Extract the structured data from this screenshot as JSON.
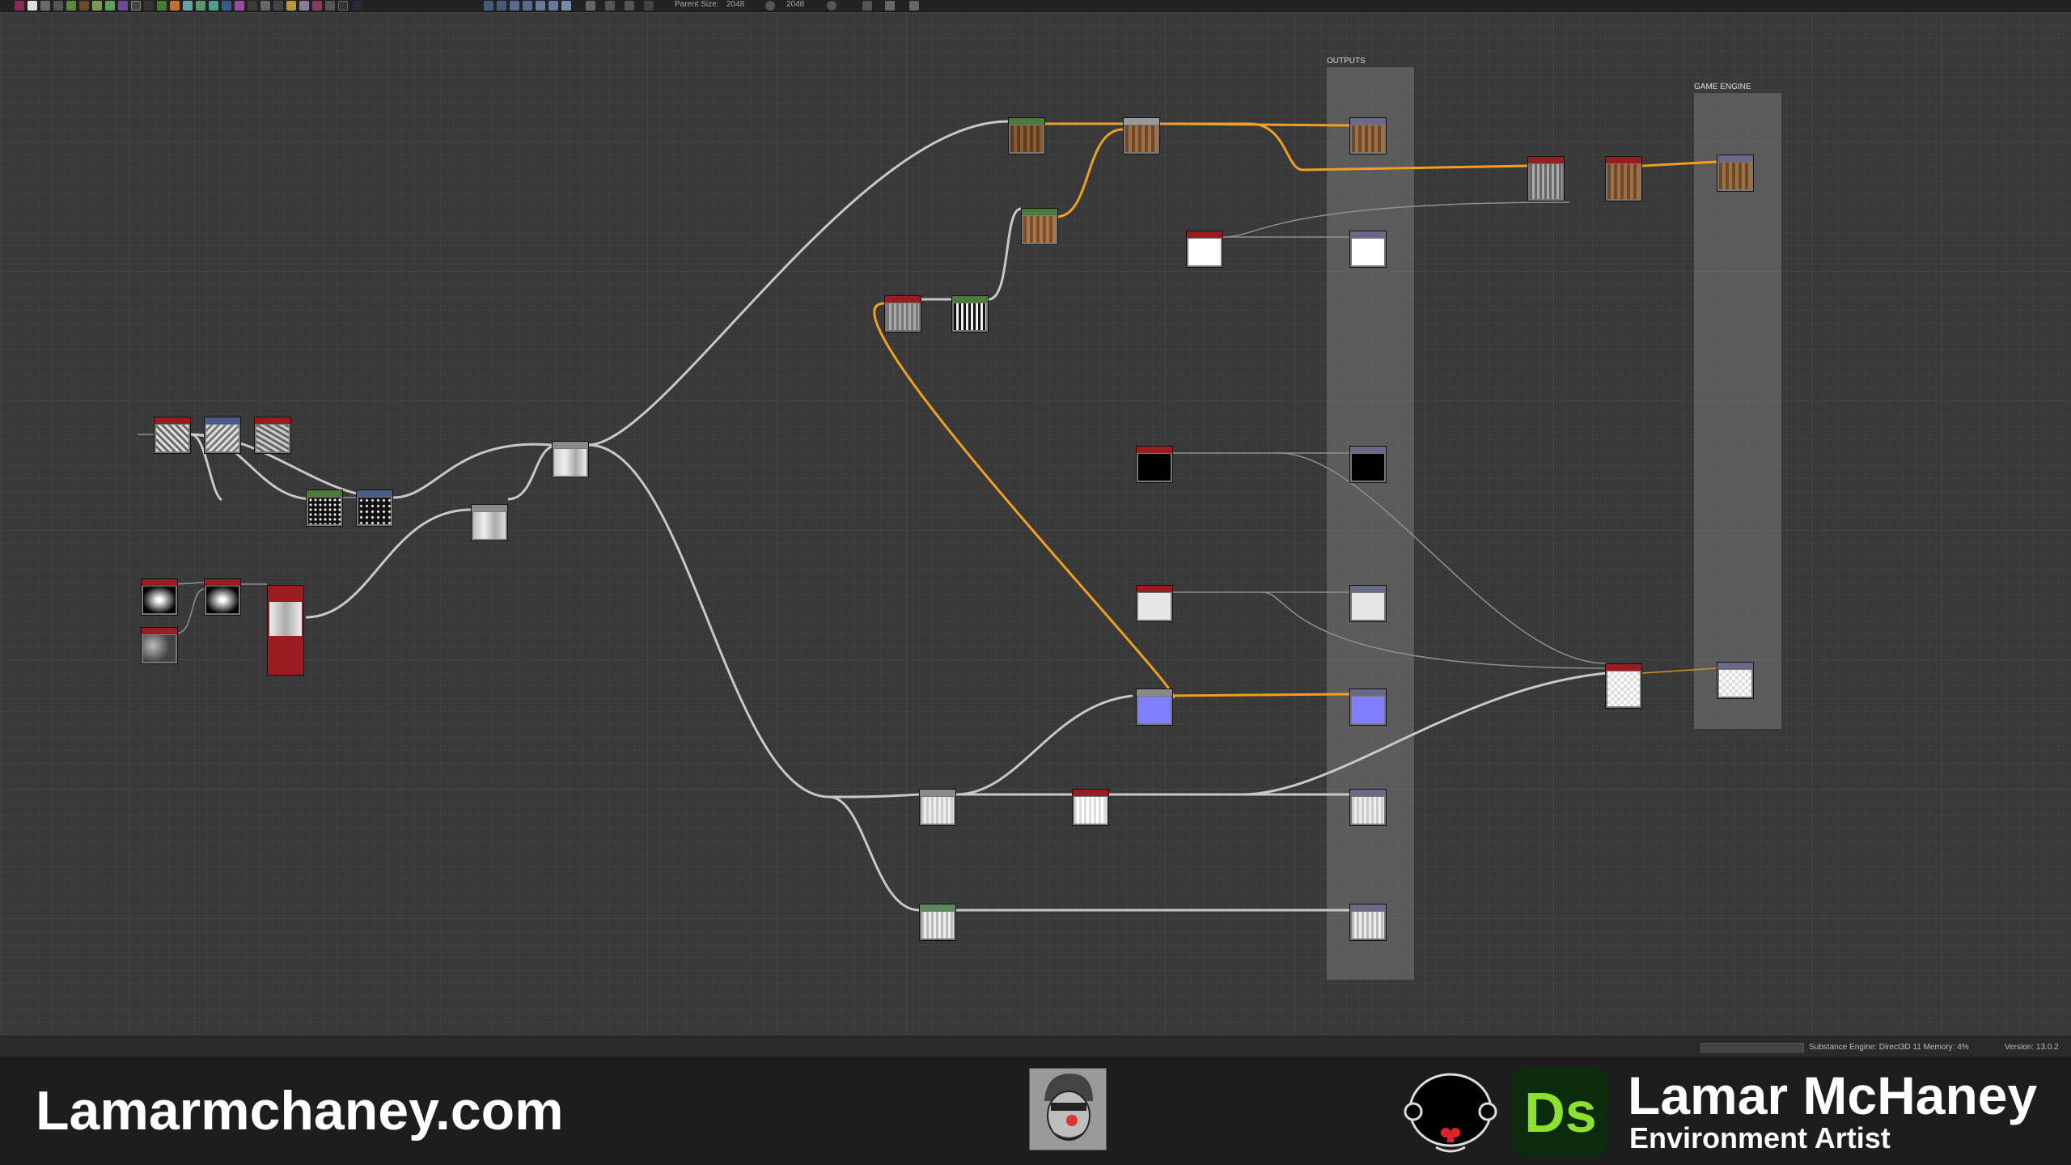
{
  "toolbar": {
    "parent_size_label": "Parent Size:",
    "parent_size_value": "2048",
    "output_size_value": "2048"
  },
  "frames": {
    "outputs_title": "OUTPUTS",
    "game_engine_title": "GAME ENGINE"
  },
  "status": {
    "engine": "Substance Engine: Direct3D 11  Memory: 4%",
    "version": "Version: 13.0.2"
  },
  "banner": {
    "website": "Lamarmchaney.com",
    "ds_logo": "Ds",
    "name": "Lamar McHaney",
    "role": "Environment Artist"
  },
  "colors": {
    "wire_default": "#c8c8c8",
    "wire_highlight": "#f0a020",
    "header_red": "#9b1c20",
    "header_green": "#4b7a3a",
    "header_blue": "#4a5a8a",
    "header_grey": "#8a8a8a",
    "header_output": "#6a6a88"
  }
}
